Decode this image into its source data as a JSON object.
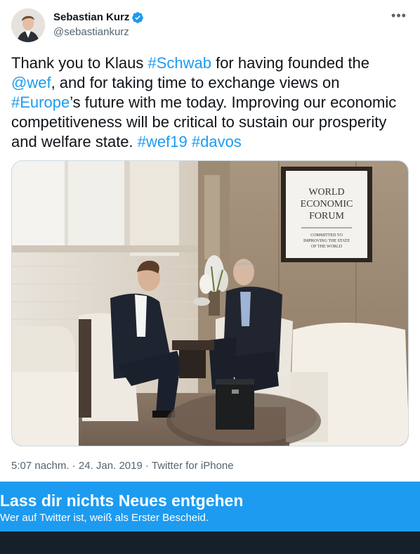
{
  "author": {
    "display_name": "Sebastian Kurz",
    "handle": "@sebastiankurz",
    "verified": true
  },
  "tweet": {
    "segments": [
      {
        "text": "Thank you to Klaus ",
        "link": false
      },
      {
        "text": "#Schwab",
        "link": true
      },
      {
        "text": " for having founded the ",
        "link": false
      },
      {
        "text": "@wef",
        "link": true
      },
      {
        "text": ", and for taking time to exchange views on ",
        "link": false
      },
      {
        "text": "#Europe",
        "link": true
      },
      {
        "text": "’s future with me today. Improving our economic competitiveness will be critical to sustain our prosperity and welfare state. ",
        "link": false
      },
      {
        "text": "#wef19",
        "link": true
      },
      {
        "text": " ",
        "link": false
      },
      {
        "text": "#davos",
        "link": true
      }
    ]
  },
  "photo": {
    "sign_lines": [
      "WORLD",
      "ECONOMIC",
      "FORUM"
    ],
    "sign_tagline": [
      "COMMITTED TO",
      "IMPROVING THE STATE",
      "OF THE WORLD"
    ]
  },
  "meta": {
    "time": "5:07 nachm.",
    "separator1": " · ",
    "date": "24. Jan. 2019",
    "separator2": " · ",
    "source": "Twitter for iPhone"
  },
  "banner": {
    "title": "Lass dir nichts Neues entgehen",
    "subtitle": "Wer auf Twitter ist, weiß als Erster Bescheid."
  },
  "colors": {
    "accent": "#1d9bf0",
    "text": "#0f1419",
    "muted": "#536471",
    "bottom_bar": "#15202b"
  }
}
